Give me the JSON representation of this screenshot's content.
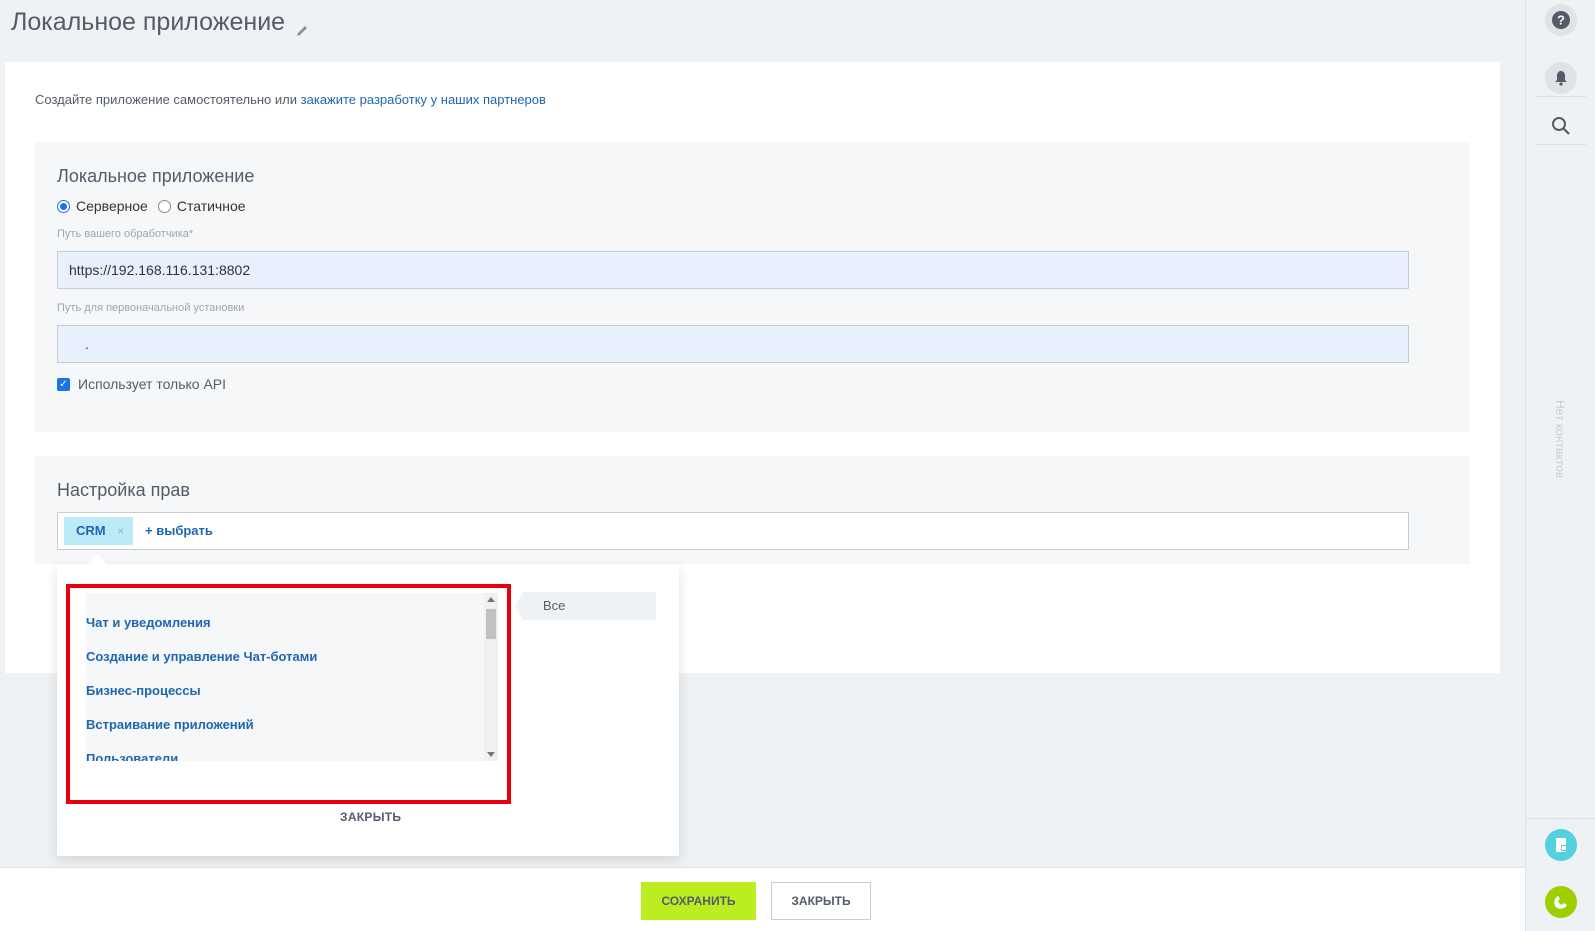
{
  "header": {
    "title": "Локальное приложение"
  },
  "intro": {
    "text": "Создайте приложение самостоятельно или ",
    "link": "закажите разработку у наших партнеров"
  },
  "local_app": {
    "title": "Локальное приложение",
    "radio_options": [
      {
        "label": "Серверное",
        "checked": true
      },
      {
        "label": "Статичное",
        "checked": false
      }
    ],
    "handler_label": "Путь вашего обработчика*",
    "handler_value": "https://192.168.116.131:8802",
    "install_label": "Путь для первоначальной установки",
    "install_value": ".",
    "api_only_label": "Использует только API",
    "api_only_checked": true
  },
  "rights": {
    "title": "Настройка прав",
    "selected_tag": "CRM",
    "tag_remove": "×",
    "add_label": "выбрать"
  },
  "popup": {
    "items": [
      "Чат и уведомления",
      "Создание и управление Чат-ботами",
      "Бизнес-процессы",
      "Встраивание приложений",
      "Пользователи"
    ],
    "tab_all": "Все",
    "close_label": "ЗАКРЫТЬ"
  },
  "footer": {
    "save_label": "СОХРАНИТЬ",
    "close_label": "ЗАКРЫТЬ"
  },
  "right_bar": {
    "vertical_text": "Нет контактов",
    "icons": [
      "help-icon",
      "bell-icon",
      "search-icon",
      "document-icon",
      "phone-icon"
    ]
  },
  "colors": {
    "accent_blue": "#2067b0",
    "save_green": "#bbed21",
    "highlight_red": "#e8000d",
    "tag_bg": "#bceaf7"
  }
}
